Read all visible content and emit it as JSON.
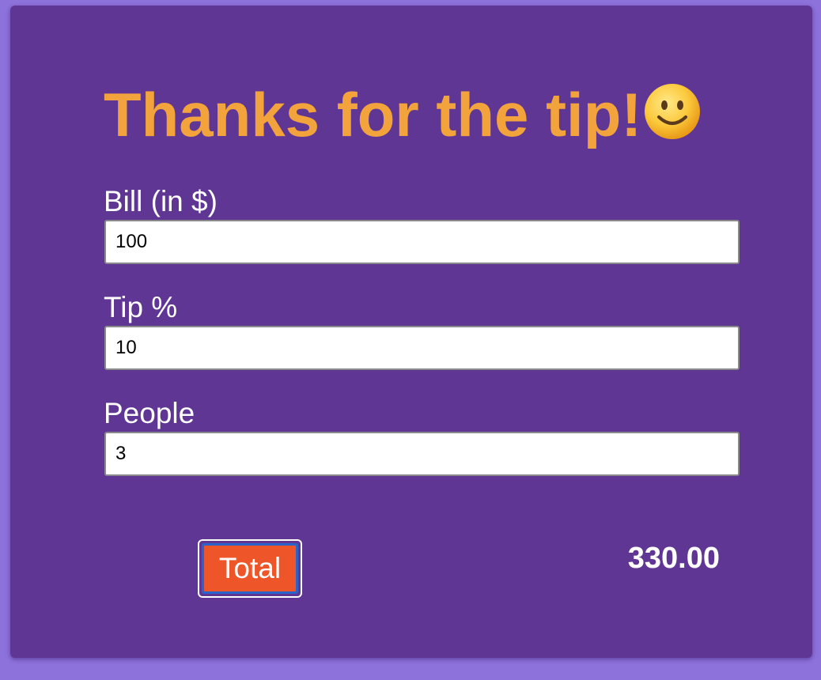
{
  "app": {
    "title": "Thanks for the tip!",
    "title_emoji": "slightly-smiling-face-icon"
  },
  "form": {
    "bill": {
      "label": "Bill (in $)",
      "value": "100"
    },
    "tip": {
      "label": "Tip %",
      "value": "10"
    },
    "people": {
      "label": "People",
      "value": "3"
    }
  },
  "actions": {
    "total_label": "Total"
  },
  "result": {
    "value": "330.00"
  },
  "colors": {
    "page_background": "#8d72dc",
    "card_background": "#603695",
    "title_color": "#f2a33c",
    "button_background": "#ee5528",
    "button_border": "#2a63c9",
    "text_color": "#ffffff"
  }
}
